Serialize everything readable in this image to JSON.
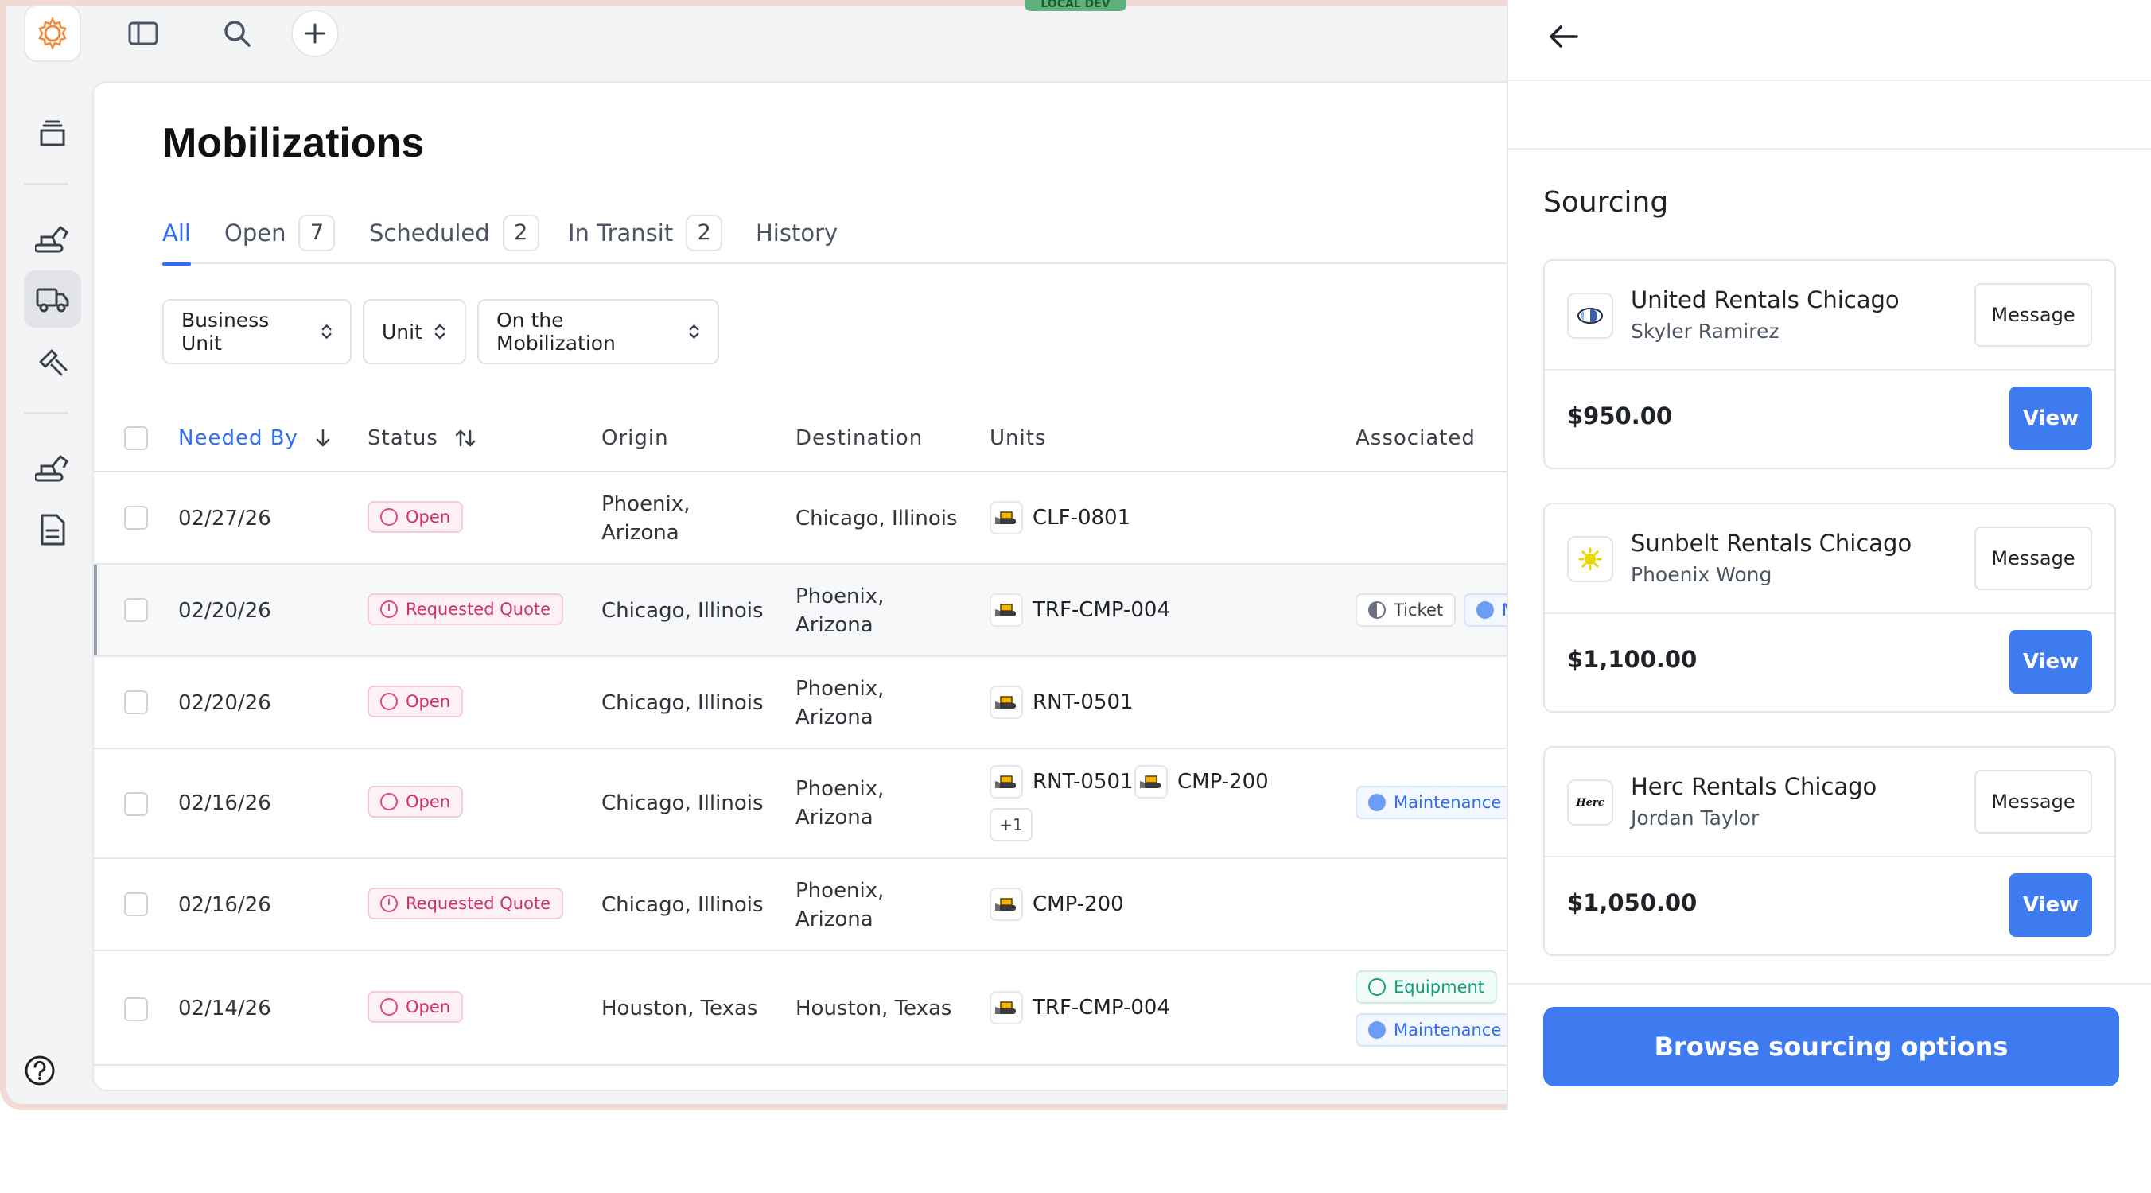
{
  "env_badge": "LOCAL DEV",
  "page": {
    "title": "Mobilizations"
  },
  "tabs": [
    {
      "label": "All"
    },
    {
      "label": "Open",
      "count": "7"
    },
    {
      "label": "Scheduled",
      "count": "2"
    },
    {
      "label": "In Transit",
      "count": "2"
    },
    {
      "label": "History"
    }
  ],
  "filters": [
    {
      "label": "Business Unit"
    },
    {
      "label": "Unit"
    },
    {
      "label": "On the Mobilization"
    }
  ],
  "table": {
    "columns": [
      "Needed By",
      "Status",
      "Origin",
      "Destination",
      "Units",
      "Associated"
    ],
    "rows": [
      {
        "needed_by": "02/27/26",
        "status": "Open",
        "origin": [
          "Phoenix,",
          "Arizona"
        ],
        "destination": [
          "Chicago, Illinois"
        ],
        "units": [
          "CLF-0801"
        ],
        "more": "",
        "associated": []
      },
      {
        "needed_by": "02/20/26",
        "status": "Requested Quote",
        "origin": [
          "Chicago, Illinois"
        ],
        "destination": [
          "Phoenix,",
          "Arizona"
        ],
        "units": [
          "TRF-CMP-004"
        ],
        "more": "",
        "associated": [
          "Ticket",
          "M"
        ]
      },
      {
        "needed_by": "02/20/26",
        "status": "Open",
        "origin": [
          "Chicago, Illinois"
        ],
        "destination": [
          "Phoenix,",
          "Arizona"
        ],
        "units": [
          "RNT-0501"
        ],
        "more": "",
        "associated": []
      },
      {
        "needed_by": "02/16/26",
        "status": "Open",
        "origin": [
          "Chicago, Illinois"
        ],
        "destination": [
          "Phoenix,",
          "Arizona"
        ],
        "units": [
          "RNT-0501",
          "CMP-200"
        ],
        "more": "+1",
        "associated": [
          "Maintenance"
        ]
      },
      {
        "needed_by": "02/16/26",
        "status": "Requested Quote",
        "origin": [
          "Chicago, Illinois"
        ],
        "destination": [
          "Phoenix,",
          "Arizona"
        ],
        "units": [
          "CMP-200"
        ],
        "more": "",
        "associated": []
      },
      {
        "needed_by": "02/14/26",
        "status": "Open",
        "origin": [
          "Houston, Texas"
        ],
        "destination": [
          "Houston, Texas"
        ],
        "units": [
          "TRF-CMP-004"
        ],
        "more": "",
        "associated": [
          "Equipment",
          "Maintenance"
        ]
      }
    ]
  },
  "panel": {
    "title": "Sourcing",
    "vendors": [
      {
        "name": "United Rentals Chicago",
        "contact": "Skyler Ramirez",
        "price": "$950.00",
        "message_label": "Message",
        "view_label": "View",
        "logo": "united-rentals-logo"
      },
      {
        "name": "Sunbelt Rentals Chicago",
        "contact": "Phoenix Wong",
        "price": "$1,100.00",
        "message_label": "Message",
        "view_label": "View",
        "logo": "sunbelt-rentals-logo"
      },
      {
        "name": "Herc Rentals Chicago",
        "contact": "Jordan Taylor",
        "price": "$1,050.00",
        "message_label": "Message",
        "view_label": "View",
        "logo": "herc-rentals-logo",
        "logo_text": "Herc"
      }
    ],
    "browse_label": "Browse sourcing options"
  },
  "colors": {
    "accent": "#2f6df6",
    "button": "#3f7bf0",
    "status_pink": "#cf2f6a",
    "equipment_green": "#13a07a"
  }
}
